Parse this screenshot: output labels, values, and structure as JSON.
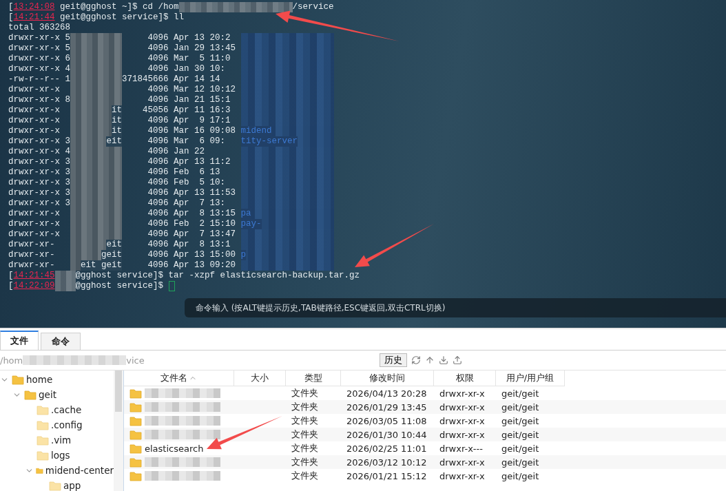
{
  "terminal": {
    "lines": [
      {
        "kind": "prompt",
        "segments": [
          {
            "kind": "text",
            "text": "["
          },
          {
            "kind": "time",
            "text": "13:24:08"
          },
          {
            "kind": "text",
            "text": " geit@gghost ~]$ cd /hom"
          },
          {
            "kind": "blur-long"
          },
          {
            "kind": "text",
            "text": "/service"
          }
        ]
      },
      {
        "kind": "prompt",
        "segments": [
          {
            "kind": "text",
            "text": "["
          },
          {
            "kind": "time",
            "text": "14:21:44"
          },
          {
            "kind": "text",
            "text": " geit@gghost service]$ ll"
          }
        ]
      },
      {
        "kind": "plain",
        "text": "total 363268"
      },
      {
        "kind": "listing",
        "perms": "drwxr-xr-x 5",
        "size": "4096",
        "date": "Apr 13 20:2"
      },
      {
        "kind": "listing",
        "perms": "drwxr-xr-x 5",
        "size": "4096",
        "date": "Jan 29 13:45"
      },
      {
        "kind": "listing",
        "perms": "drwxr-xr-x 6",
        "size": "4096",
        "date": "Mar  5 11:0"
      },
      {
        "kind": "listing",
        "perms": "drwxr-xr-x 4",
        "size": "4096",
        "date": "Jan 30 10:"
      },
      {
        "kind": "listing",
        "perms": "-rw-r--r-- 1",
        "size": "371845666",
        "date": "Apr 14 14"
      },
      {
        "kind": "listing",
        "perms": "drwxr-xr-x",
        "size": "4096",
        "date": "Mar 12 10:12"
      },
      {
        "kind": "listing",
        "perms": "drwxr-xr-x 8",
        "size": "4096",
        "date": "Jan 21 15:1"
      },
      {
        "kind": "listing",
        "perms": "drwxr-xr-x",
        "owner": "it",
        "size": "45056",
        "date": "Apr 11 16:3"
      },
      {
        "kind": "listing",
        "perms": "drwxr-xr-x",
        "owner": "it",
        "size": "4096",
        "date": "Apr  9 17:1"
      },
      {
        "kind": "listing",
        "perms": "drwxr-xr-x",
        "owner": "it",
        "size": "4096",
        "date": "Mar 16 09:08",
        "name": "midend"
      },
      {
        "kind": "listing",
        "perms": "drwxr-xr-x 3",
        "owner": "eit",
        "size": "4096",
        "date": "Mar  6 09:",
        "name": "tity-server"
      },
      {
        "kind": "listing",
        "perms": "drwxr-xr-x 4",
        "size": "4096",
        "date": "Jan 22"
      },
      {
        "kind": "listing",
        "perms": "drwxr-xr-x 3",
        "size": "4096",
        "date": "Apr 13 11:2"
      },
      {
        "kind": "listing",
        "perms": "drwxr-xr-x 3",
        "size": "4096",
        "date": "Feb  6 13"
      },
      {
        "kind": "listing",
        "perms": "drwxr-xr-x 3",
        "size": "4096",
        "date": "Feb  5 10:"
      },
      {
        "kind": "listing",
        "perms": "drwxr-xr-x 3",
        "size": "4096",
        "date": "Apr 13 11:53"
      },
      {
        "kind": "listing",
        "perms": "drwxr-xr-x 3",
        "size": "4096",
        "date": "Apr  7 13:"
      },
      {
        "kind": "listing",
        "perms": "drwxr-xr-x",
        "size": "4096",
        "date": "Apr  8 13:15",
        "name": "pa"
      },
      {
        "kind": "listing",
        "perms": "drwxr-xr-x",
        "size": "4096",
        "date": "Feb  2 15:10",
        "name": "pay-"
      },
      {
        "kind": "listing",
        "perms": "drwxr-xr-x",
        "size": "4096",
        "date": "Apr  7 13:47"
      },
      {
        "kind": "listing",
        "perms": "drwxr-xr-",
        "owner": "eit",
        "size": "4096",
        "date": "Apr  8 13:1"
      },
      {
        "kind": "listing",
        "perms": "drwxr-xr-",
        "owner": "geit",
        "size": "4096",
        "date": "Apr 13 15:00",
        "name": "p"
      },
      {
        "kind": "listing",
        "perms": "drwxr-xr-",
        "owner": "eit geit",
        "size": "4096",
        "date": "Apr 13 09:20"
      },
      {
        "kind": "prompt",
        "segments": [
          {
            "kind": "text",
            "text": "["
          },
          {
            "kind": "time",
            "text": "14:21:45"
          },
          {
            "kind": "blur-short"
          },
          {
            "kind": "text",
            "text": "@gghost service]$ tar -xzpf elasticsearch-backup.tar.gz"
          }
        ]
      },
      {
        "kind": "prompt",
        "segments": [
          {
            "kind": "text",
            "text": "["
          },
          {
            "kind": "time",
            "text": "14:22:09"
          },
          {
            "kind": "blur-short"
          },
          {
            "kind": "text",
            "text": "@gghost service]$ "
          },
          {
            "kind": "cursor"
          }
        ]
      }
    ],
    "hint": "命令输入 (按ALT键提示历史,TAB键路径,ESC键返回,双击CTRL切换)"
  },
  "tabs": [
    {
      "label": "文件",
      "selected": true
    },
    {
      "label": "命令",
      "selected": false
    }
  ],
  "path": {
    "start": "/hom",
    "end": "vice"
  },
  "history_button": "历史",
  "tree": [
    {
      "name": "home",
      "expanded": true,
      "children": [
        {
          "name": "geit",
          "expanded": true,
          "children": [
            {
              "name": ".cache"
            },
            {
              "name": ".config"
            },
            {
              "name": ".vim"
            },
            {
              "name": "logs"
            },
            {
              "name": "midend-center",
              "expanded": true,
              "children": [
                {
                  "name": "app"
                }
              ]
            }
          ]
        }
      ]
    }
  ],
  "table": {
    "columns": [
      "文件名",
      "大小",
      "类型",
      "修改时间",
      "权限",
      "用户/用户组"
    ],
    "rows": [
      {
        "type": "文件夹",
        "modified": "2026/04/13 20:28",
        "perms": "drwxr-xr-x",
        "owner": "geit/geit"
      },
      {
        "type": "文件夹",
        "modified": "2026/01/29 13:45",
        "perms": "drwxr-xr-x",
        "owner": "geit/geit"
      },
      {
        "type": "文件夹",
        "modified": "2026/03/05 11:08",
        "perms": "drwxr-xr-x",
        "owner": "geit/geit"
      },
      {
        "type": "文件夹",
        "modified": "2026/01/30 10:44",
        "perms": "drwxr-xr-x",
        "owner": "geit/geit"
      },
      {
        "name": "elasticsearch",
        "type": "文件夹",
        "modified": "2026/02/25 11:01",
        "perms": "drwxr-x---",
        "owner": "geit/geit"
      },
      {
        "type": "文件夹",
        "modified": "2026/03/12 10:12",
        "perms": "drwxr-xr-x",
        "owner": "geit/geit"
      },
      {
        "type": "文件夹",
        "modified": "2026/01/21 15:12",
        "perms": "drwxr-xr-x",
        "owner": "geit/geit"
      }
    ]
  }
}
